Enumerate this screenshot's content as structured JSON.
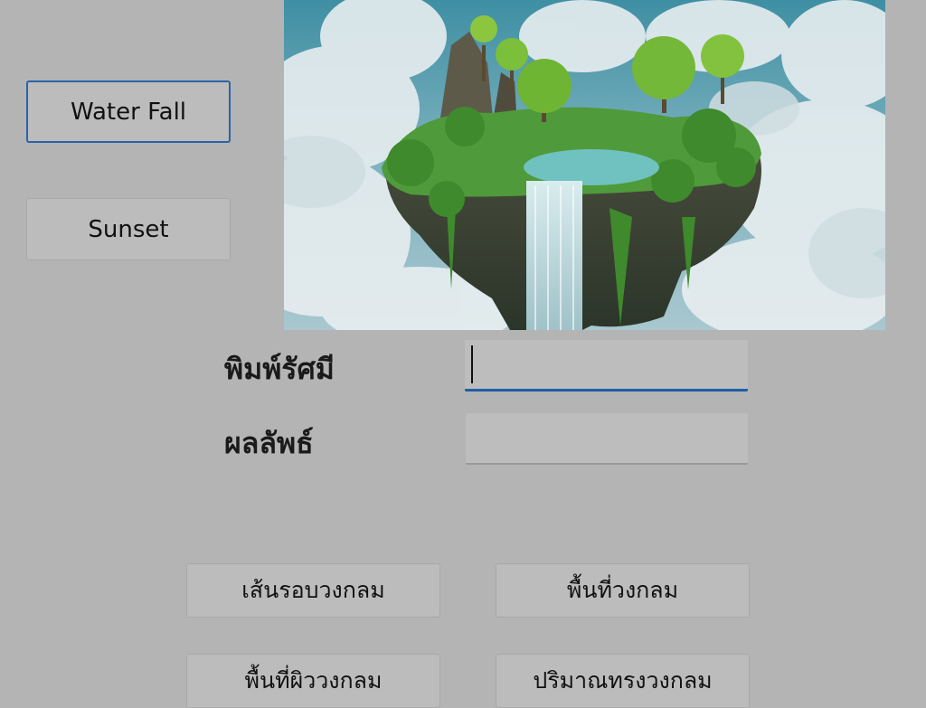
{
  "buttons": {
    "waterfall": "Water Fall",
    "sunset": "Sunset",
    "circumference": "เส้นรอบวงกลม",
    "area": "พื้นที่วงกลม",
    "surface_area": "พื้นที่ผิววงกลม",
    "volume": "ปริมาณทรงวงกลม"
  },
  "labels": {
    "radius": "พิมพ์รัศมี",
    "result": "ผลลัพธ์"
  },
  "inputs": {
    "radius_value": "",
    "result_value": ""
  },
  "image": {
    "subject": "floating-island-waterfall"
  },
  "colors": {
    "background": "#b4b4b4",
    "focus_accent": "#2a63a8"
  }
}
